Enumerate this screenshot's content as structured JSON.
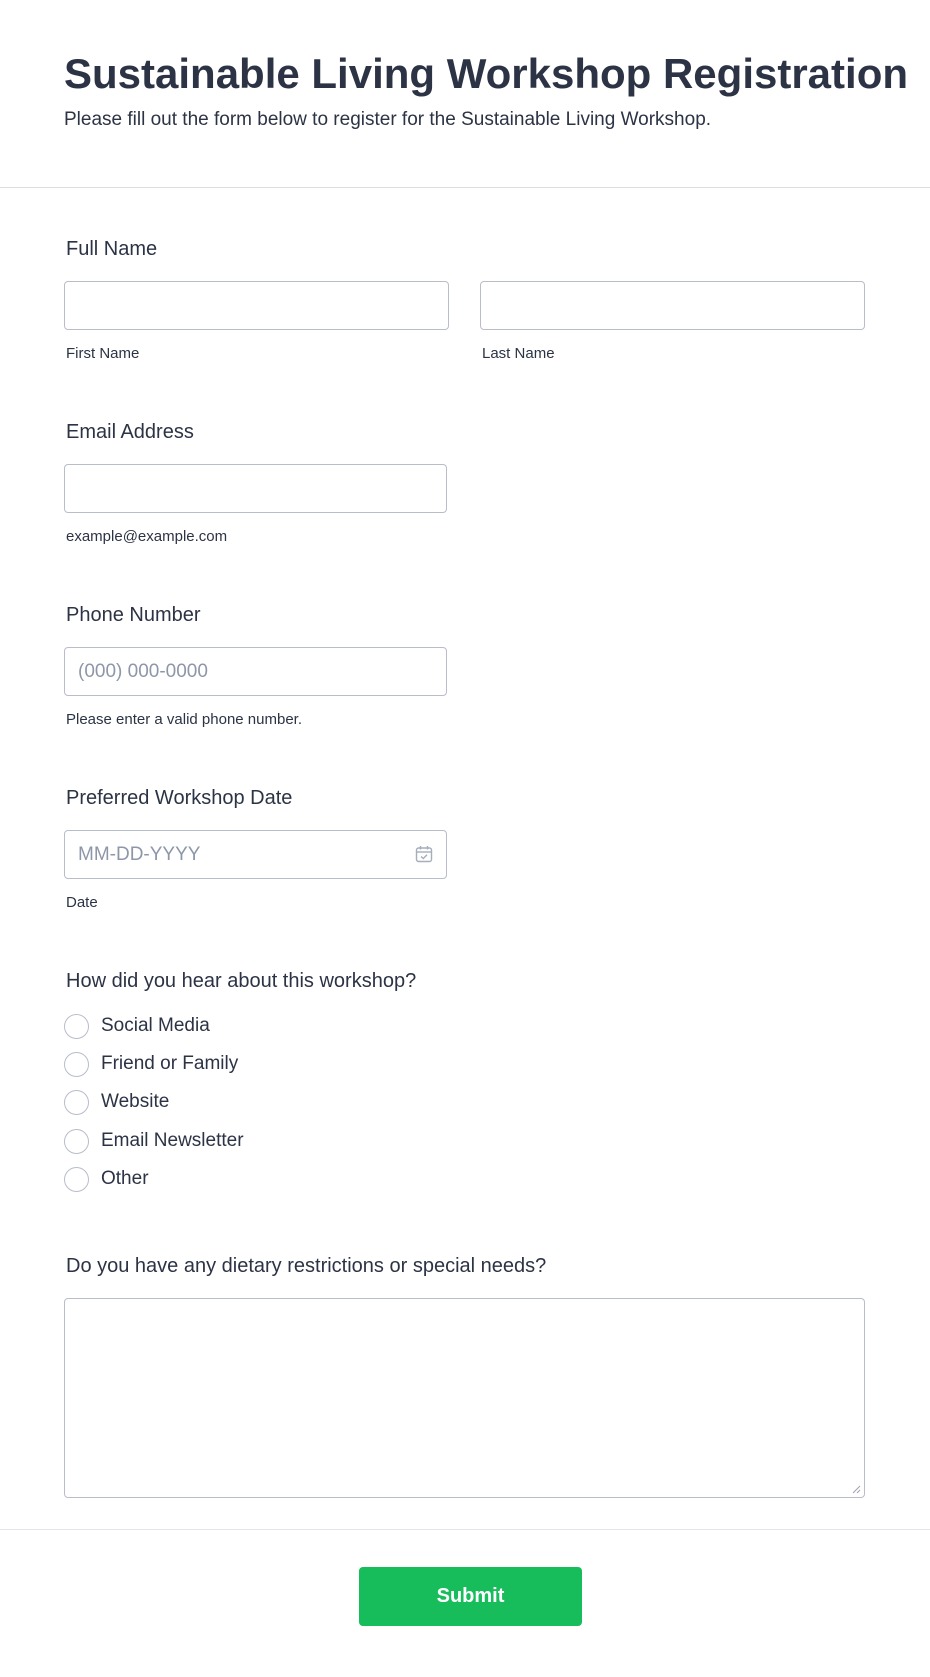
{
  "header": {
    "title": "Sustainable Living Workshop Registration",
    "subtitle": "Please fill out the form below to register for the Sustainable Living Workshop."
  },
  "full_name": {
    "label": "Full Name",
    "first_value": "",
    "first_sublabel": "First Name",
    "last_value": "",
    "last_sublabel": "Last Name"
  },
  "email": {
    "label": "Email Address",
    "value": "",
    "sublabel": "example@example.com"
  },
  "phone": {
    "label": "Phone Number",
    "placeholder": "(000) 000-0000",
    "sublabel": "Please enter a valid phone number."
  },
  "date": {
    "label": "Preferred Workshop Date",
    "placeholder": "MM-DD-YYYY",
    "icon": "calendar-icon",
    "sublabel": "Date"
  },
  "source": {
    "label": "How did you hear about this workshop?",
    "options": [
      "Social Media",
      "Friend or Family",
      "Website",
      "Email Newsletter",
      "Other"
    ]
  },
  "dietary": {
    "label": "Do you have any dietary restrictions or special needs?",
    "value": ""
  },
  "submit": {
    "label": "Submit"
  },
  "colors": {
    "accent": "#18bd5b",
    "text": "#2c3345",
    "border": "#b8bdc9"
  }
}
